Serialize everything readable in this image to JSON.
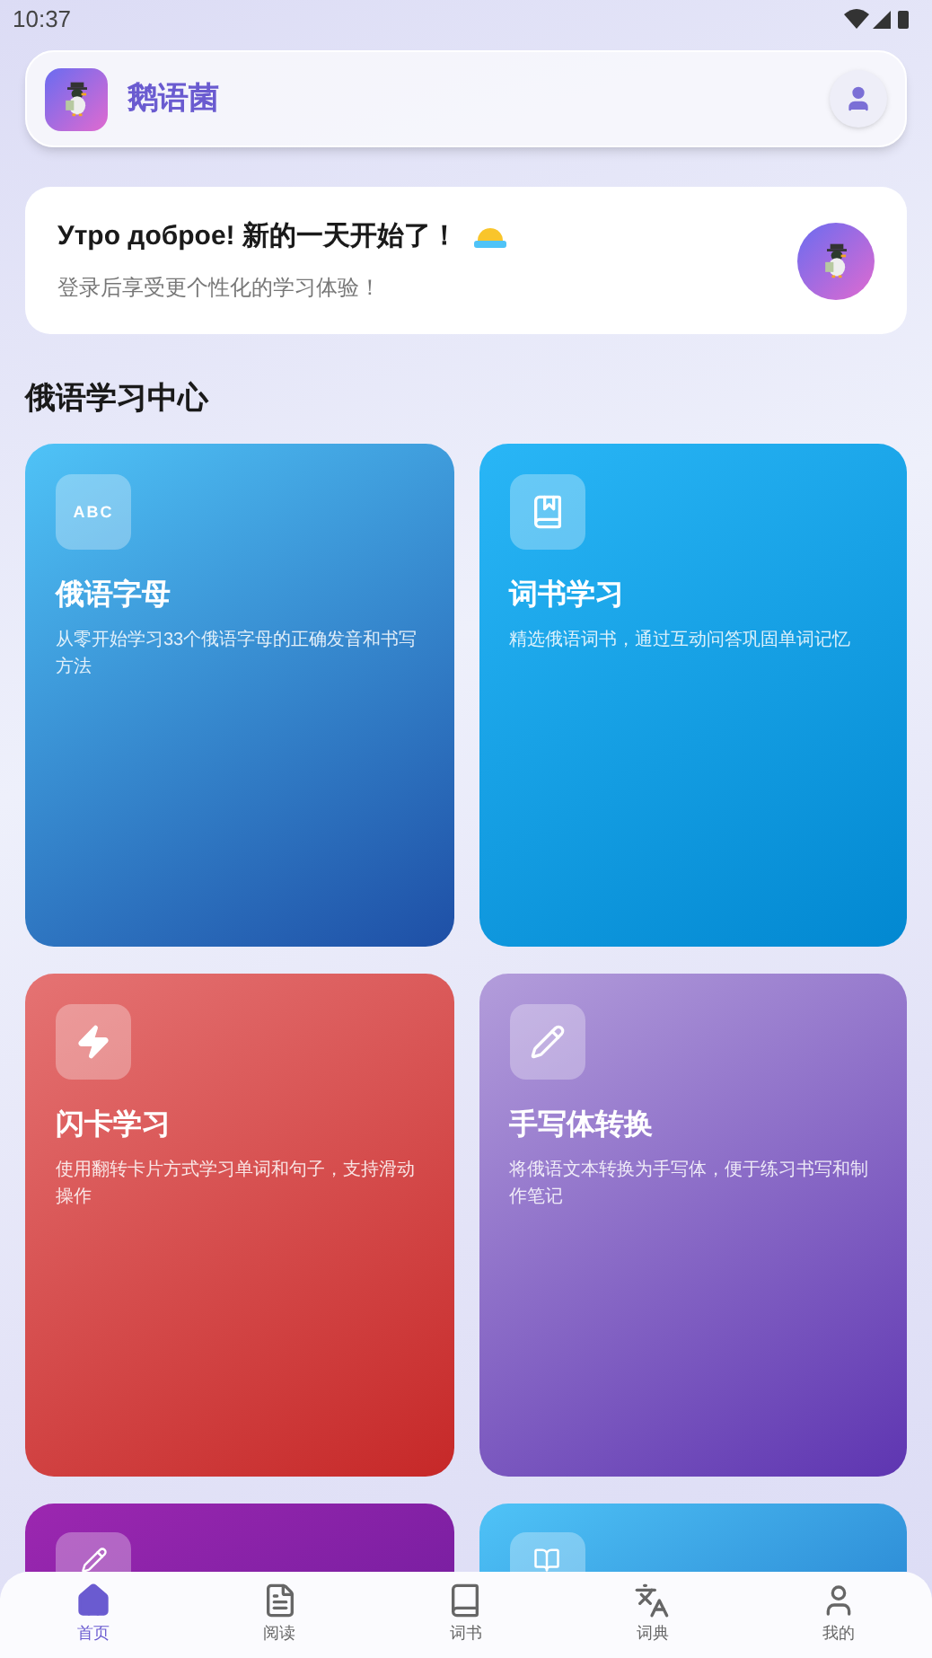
{
  "status_bar": {
    "time": "10:37"
  },
  "header": {
    "app_name": "鹅语菌"
  },
  "greeting": {
    "title": "Утро доброе! 新的一天开始了！",
    "subtitle": "登录后享受更个性化的学习体验！"
  },
  "section_title": "俄语学习中心",
  "cards": [
    {
      "kind": "alphabet",
      "icon_text": "ABC",
      "title": "俄语字母",
      "description": "从零开始学习33个俄语字母的正确发音和书写方法"
    },
    {
      "kind": "wordbook",
      "title": "词书学习",
      "description": "精选俄语词书，通过互动问答巩固单词记忆"
    },
    {
      "kind": "flashcard",
      "title": "闪卡学习",
      "description": "使用翻转卡片方式学习单词和句子，支持滑动操作"
    },
    {
      "kind": "handwriting",
      "title": "手写体转换",
      "description": "将俄语文本转换为手写体，便于练习书写和制作笔记"
    },
    {
      "kind": "writing"
    },
    {
      "kind": "reading"
    }
  ],
  "nav": [
    {
      "kind": "home",
      "label": "首页",
      "selected": true
    },
    {
      "kind": "reading",
      "label": "阅读",
      "selected": false
    },
    {
      "kind": "wordbook",
      "label": "词书",
      "selected": false
    },
    {
      "kind": "dictionary",
      "label": "词典",
      "selected": false
    },
    {
      "kind": "profile",
      "label": "我的",
      "selected": false
    }
  ]
}
